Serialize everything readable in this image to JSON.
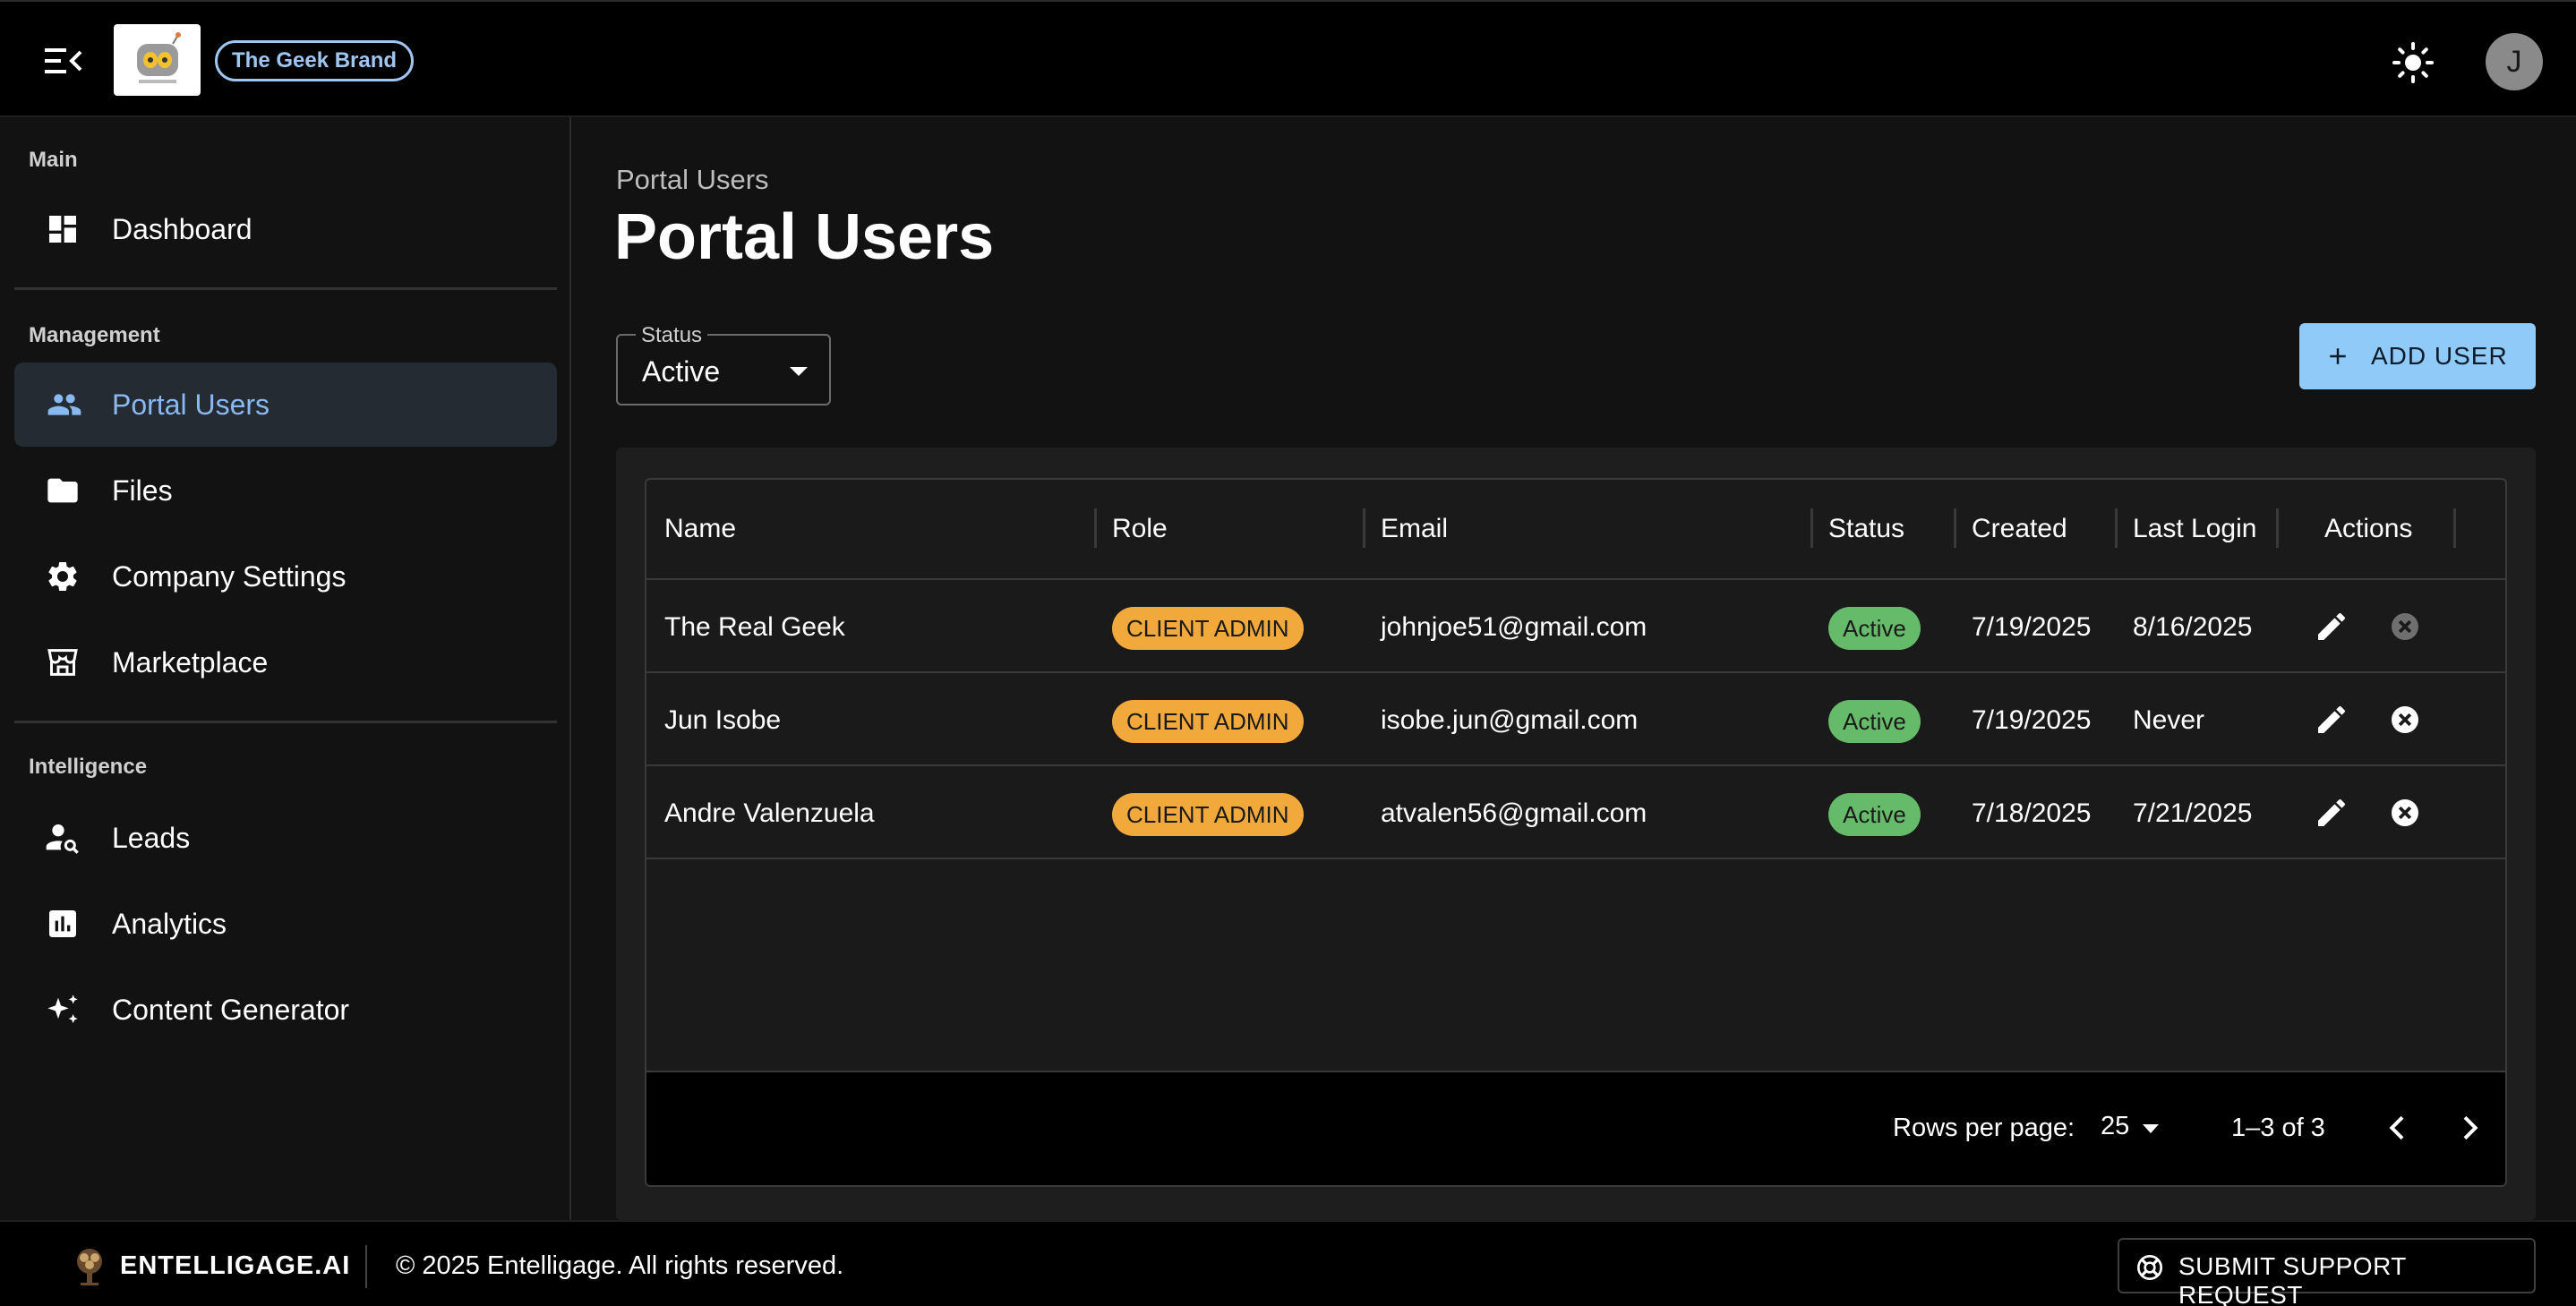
{
  "header": {
    "brand_chip": "The Geek Brand",
    "avatar_initial": "J"
  },
  "sidebar": {
    "sections": [
      {
        "label": "Main"
      },
      {
        "label": "Management"
      },
      {
        "label": "Intelligence"
      }
    ],
    "items": [
      {
        "label": "Dashboard",
        "icon": "dashboard-icon"
      },
      {
        "label": "Portal Users",
        "icon": "people-icon",
        "active": true
      },
      {
        "label": "Files",
        "icon": "folder-icon"
      },
      {
        "label": "Company Settings",
        "icon": "gear-icon"
      },
      {
        "label": "Marketplace",
        "icon": "storefront-icon"
      },
      {
        "label": "Leads",
        "icon": "person-search-icon"
      },
      {
        "label": "Analytics",
        "icon": "bar-chart-icon"
      },
      {
        "label": "Content Generator",
        "icon": "sparkle-icon"
      }
    ]
  },
  "main": {
    "breadcrumb": "Portal Users",
    "title": "Portal Users",
    "status_filter": {
      "label": "Status",
      "value": "Active"
    },
    "add_user_label": "ADD USER"
  },
  "table": {
    "columns": [
      "Name",
      "Role",
      "Email",
      "Status",
      "Created",
      "Last Login",
      "Actions"
    ],
    "rows": [
      {
        "name": "The Real Geek",
        "role": "CLIENT ADMIN",
        "email": "johnjoe51@gmail.com",
        "status": "Active",
        "created": "7/19/2025",
        "last_login": "8/16/2025"
      },
      {
        "name": "Jun Isobe",
        "role": "CLIENT ADMIN",
        "email": "isobe.jun@gmail.com",
        "status": "Active",
        "created": "7/19/2025",
        "last_login": "Never"
      },
      {
        "name": "Andre Valenzuela",
        "role": "CLIENT ADMIN",
        "email": "atvalen56@gmail.com",
        "status": "Active",
        "created": "7/18/2025",
        "last_login": "7/21/2025"
      }
    ],
    "footer": {
      "rows_per_page_label": "Rows per page:",
      "rows_per_page_value": "25",
      "range": "1–3 of 3"
    }
  },
  "footer": {
    "company": "ENTELLIGAGE.AI",
    "copyright": "© 2025 Entelligage. All rights reserved.",
    "support_label": "SUBMIT SUPPORT REQUEST"
  },
  "colors": {
    "accent": "#90caf9",
    "active_nav_text": "#8ab8f0",
    "role_chip": "#f2a93b",
    "status_chip": "#66bb6a",
    "background": "#121212"
  }
}
